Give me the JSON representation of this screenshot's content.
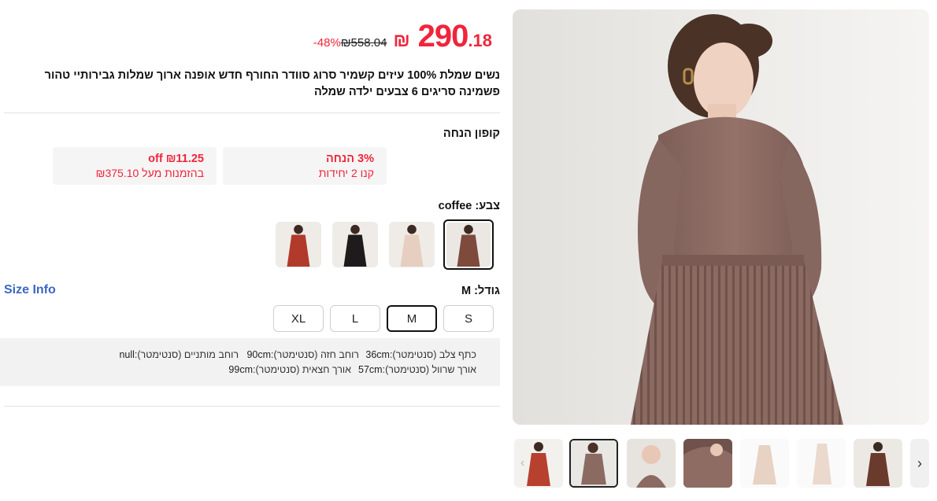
{
  "price": {
    "currency": "₪",
    "integer": "290",
    "decimal": ".18",
    "original": "₪558.04",
    "discount": "-48%"
  },
  "product_title": "נשים שמלת 100% עיזים קשמיר סרוג סוודר החורף חדש אופנה ארוך שמלות גבירותיי טהור פשמינה סריגים 6 צבעים ילדה שמלה",
  "coupons": {
    "label": "קופון הנחה",
    "items": [
      {
        "main": "3% הנחה",
        "sub": "קנו 2 יחידות"
      },
      {
        "main": "₪11.25 off",
        "sub": "בהזמנות מעל ₪375.10"
      }
    ]
  },
  "color": {
    "label": "צבע: coffee",
    "swatches": [
      "coffee",
      "apricot",
      "black",
      "red"
    ],
    "selected": "coffee"
  },
  "size": {
    "label": "גודל: M",
    "size_info": "Size Info",
    "options": [
      "S",
      "M",
      "L",
      "XL"
    ],
    "selected": "M"
  },
  "measurements": {
    "row1": [
      {
        "label": "כתף צלב (סנטימטר):",
        "value": "36cm"
      },
      {
        "label": "רוחב חזה (סנטימטר):",
        "value": "90cm"
      },
      {
        "label": "רוחב מותניים (סנטימטר):",
        "value": "null"
      }
    ],
    "row2": [
      {
        "label": "אורך שרוול (סנטימטר):",
        "value": "57cm"
      },
      {
        "label": "אורך חצאית (סנטימטר):",
        "value": "99cm"
      }
    ]
  },
  "gallery": {
    "thumbnails": [
      "red-dress",
      "coffee-dress",
      "coffee-portrait",
      "coffee-detail",
      "apricot-flat",
      "apricot-side",
      "brown-dress"
    ],
    "selected_index": 1
  },
  "colors": {
    "accent_red": "#f0253b",
    "link_blue": "#3b66c4",
    "coffee": "#8e6c64"
  }
}
